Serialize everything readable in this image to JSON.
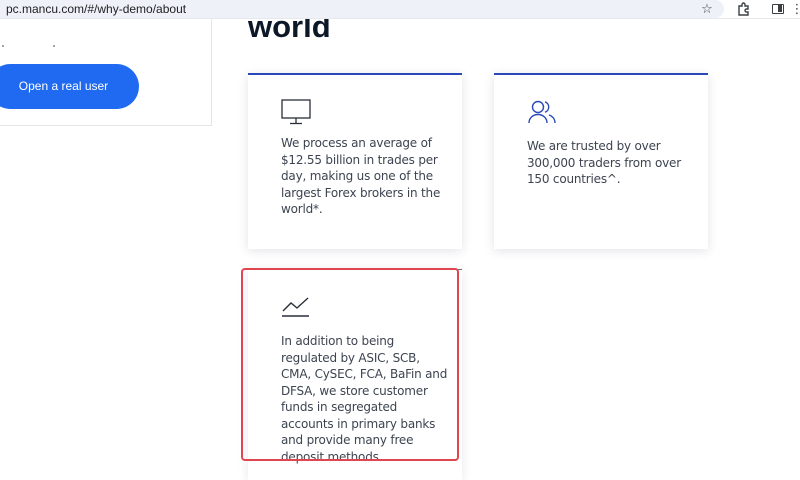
{
  "browser": {
    "url": "pc.mancu.com/#/why-demo/about",
    "icons": [
      "star-icon",
      "extension-icon",
      "sidebar-icon",
      "menu-icon"
    ]
  },
  "left_panel": {
    "button_label": "Open a real user",
    "button_color": "#1f6af0"
  },
  "heading": {
    "text": "world"
  },
  "cards": [
    {
      "icon": "monitor-icon",
      "text": "We process an average of $12.55 billion in trades per day, making us one of the largest Forex brokers in the world*."
    },
    {
      "icon": "users-icon",
      "text": "We are trusted by over 300,000 traders from over 150 countries^."
    },
    {
      "icon": "trend-chart-icon",
      "text": "In addition to being regulated by ASIC, SCB, CMA, CySEC, FCA, BaFin and DFSA, we store customer funds in segregated accounts in primary banks and provide many free deposit methods."
    }
  ],
  "colors": {
    "accent_border": "#2949b9",
    "highlight": "#e0464f"
  }
}
